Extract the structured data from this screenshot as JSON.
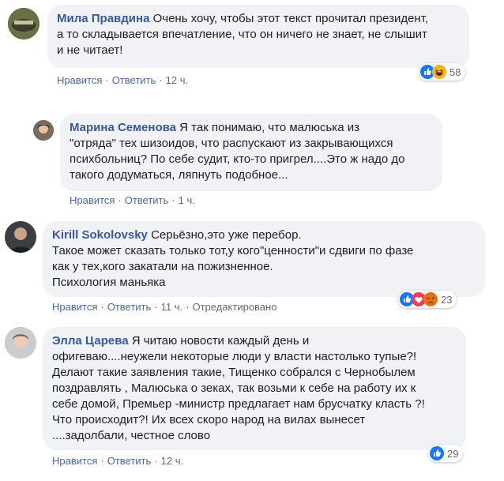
{
  "comments": [
    {
      "author": "Мила Правдина",
      "text": "Очень хочу, чтобы этот текст прочитал президент,\nа то складывается впечатление, что он ничего не знает, не слышит\nи не читает!",
      "like_label": "Нравится",
      "reply_label": "Ответить",
      "time": "12 ч.",
      "reactions": [
        "like-icon",
        "haha-icon"
      ],
      "reaction_count": "58"
    },
    {
      "author": "Марина Семенова",
      "text": "Я так понимаю, что малюська из\n\"отряда\" тех шизоидов, что распускают из закрывающихся\nпсихбольниц? По себе судит, кто-то пригрел....Это ж надо до\nтакого додуматься, ляпнуть подобное...",
      "like_label": "Нравится",
      "reply_label": "Ответить",
      "time": "1 ч."
    },
    {
      "author": "Kirill Sokolovsky",
      "text": "Серьёзно,это уже перебор.\nТакое может сказать только тот,у кого\"ценности\"и сдвиги по фазе\nкак у тех,кого закатали на пожизненное.\nПсихология маньяка",
      "like_label": "Нравится",
      "reply_label": "Ответить",
      "time": "11 ч.",
      "edited_label": "Отредактировано",
      "reactions": [
        "like-icon",
        "love-icon",
        "angry-icon"
      ],
      "reaction_count": "23"
    },
    {
      "author": "Элла Царева",
      "text": "Я читаю новости каждый день и\nофигеваю....неужели некоторые люди у власти настолько тупые?!\nДелают такие заявления такие, Тищенко собрался с Чернобылем\nпоздравлять , Малюська о зеках, так возьми к себе на работу их к\nсебе домой, Премьер -министр предлагает нам брусчатку класть ?!\nЧто происходит?! Их всех скоро народ на вилах вынесет\n....задолбали, честное слово",
      "like_label": "Нравится",
      "reply_label": "Ответить",
      "time": "12 ч.",
      "reactions": [
        "like-icon"
      ],
      "reaction_count": "29"
    }
  ],
  "colors": {
    "author": "#385898",
    "bubble": "#f0f2f5",
    "action_link": "#4b67a1",
    "like_blue": "#1877f2",
    "love_red": "#f33e58",
    "haha_yellow": "#f7b125",
    "angry_orange": "#e9710f"
  }
}
